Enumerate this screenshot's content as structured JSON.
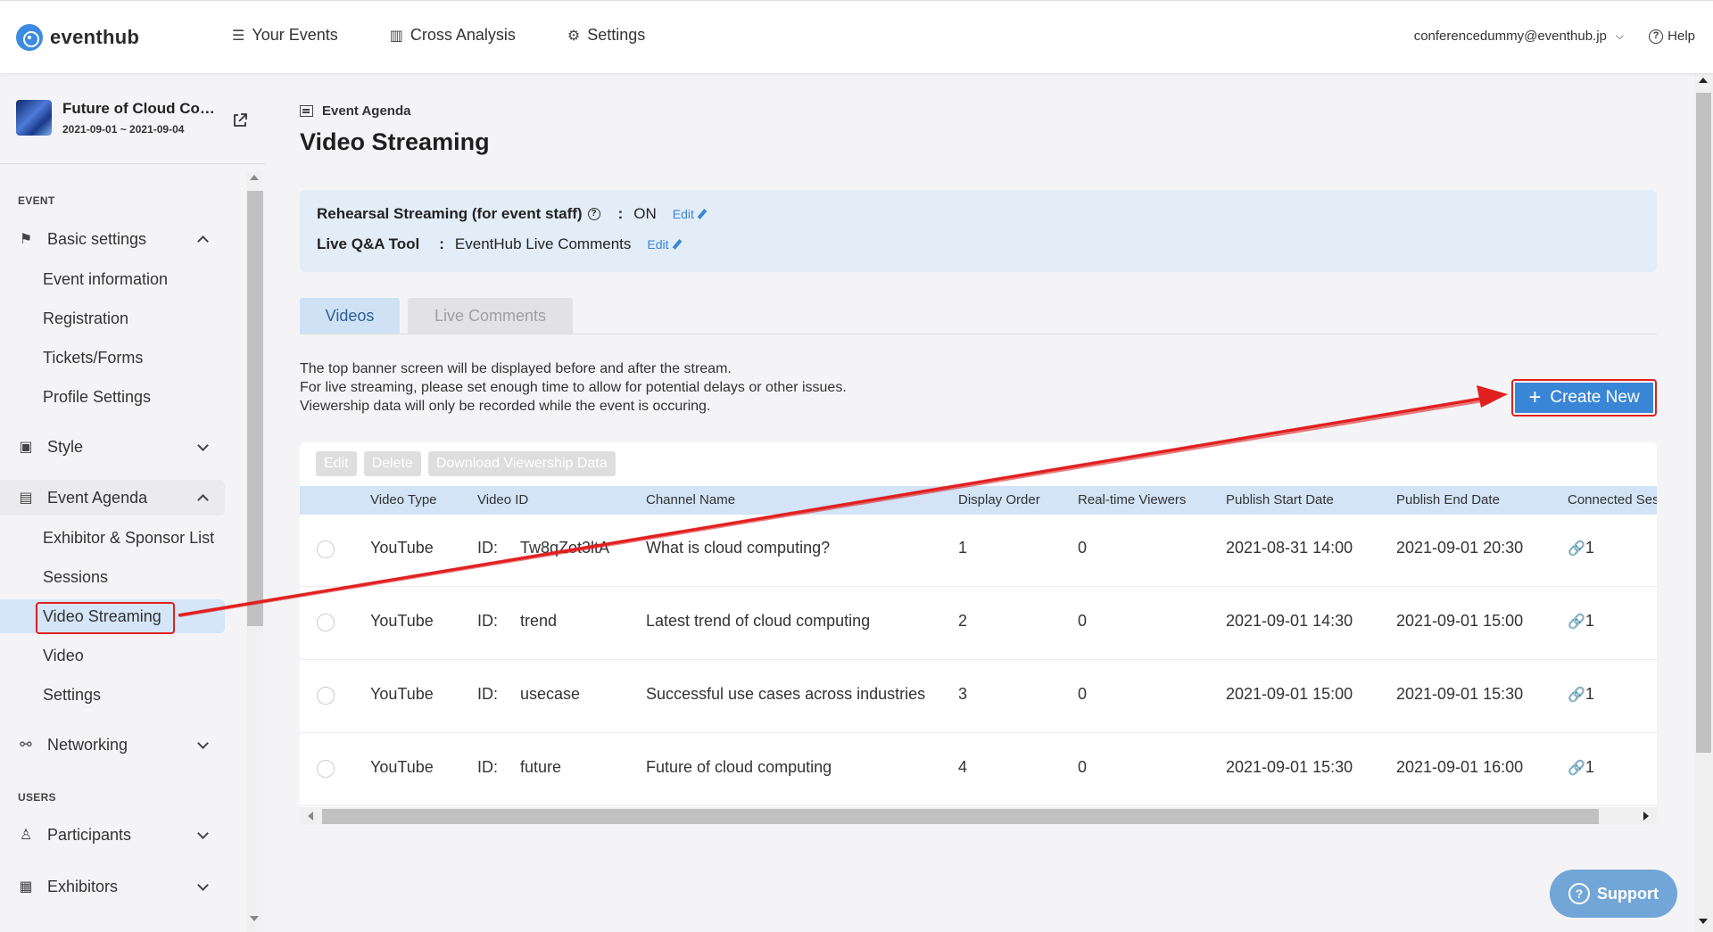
{
  "app": {
    "logo": "eventhub"
  },
  "topnav": [
    {
      "icon": "list-icon",
      "label": "Your Events"
    },
    {
      "icon": "bar-chart-icon",
      "label": "Cross Analysis"
    },
    {
      "icon": "gear-icon",
      "label": "Settings"
    }
  ],
  "user": {
    "email": "conferencedummy@eventhub.jp",
    "help": "Help"
  },
  "event": {
    "title": "Future of Cloud Computing",
    "dates": "2021-09-01 ~ 2021-09-04"
  },
  "sidebar": {
    "section_event": "EVENT",
    "section_users": "USERS",
    "groups": {
      "basic": "Basic settings",
      "style": "Style",
      "agenda": "Event Agenda",
      "networking": "Networking",
      "participants": "Participants",
      "exhibitors": "Exhibitors"
    },
    "basic_items": [
      "Event information",
      "Registration",
      "Tickets/Forms",
      "Profile Settings"
    ],
    "agenda_items": [
      "Exhibitor & Sponsor List",
      "Sessions",
      "Video Streaming",
      "Video",
      "Settings"
    ]
  },
  "page": {
    "breadcrumb": "Event Agenda",
    "title": "Video Streaming"
  },
  "info": {
    "rehearsal_label": "Rehearsal Streaming (for event staff)",
    "rehearsal_value": "ON",
    "qa_label": "Live Q&A Tool",
    "qa_value": "EventHub Live Comments",
    "edit": "Edit",
    "sep": ":"
  },
  "tabs": [
    "Videos",
    "Live Comments"
  ],
  "notes": [
    "The top banner screen will be displayed before and after the stream.",
    "For live streaming, please set enough time to allow for potential delays or other issues.",
    "Viewership data will only be recorded while the event is occuring."
  ],
  "create_button": "Create New",
  "table": {
    "actions": [
      "Edit",
      "Delete",
      "Download Viewership Data"
    ],
    "columns": [
      "Video Type",
      "Video ID",
      "Channel Name",
      "Display Order",
      "Real-time Viewers",
      "Publish Start Date",
      "Publish End Date",
      "Connected Ses"
    ],
    "id_prefix": "ID:",
    "rows": [
      {
        "type": "YouTube",
        "id": "Tw8qZot3ltA",
        "channel": "What is cloud computing?",
        "order": "1",
        "viewers": "0",
        "start": "2021-08-31 14:00",
        "end": "2021-09-01 20:30",
        "sessions": "1"
      },
      {
        "type": "YouTube",
        "id": "trend",
        "channel": "Latest trend of cloud computing",
        "order": "2",
        "viewers": "0",
        "start": "2021-09-01 14:30",
        "end": "2021-09-01 15:00",
        "sessions": "1"
      },
      {
        "type": "YouTube",
        "id": "usecase",
        "channel": "Successful use cases across industries",
        "order": "3",
        "viewers": "0",
        "start": "2021-09-01 15:00",
        "end": "2021-09-01 15:30",
        "sessions": "1"
      },
      {
        "type": "YouTube",
        "id": "future",
        "channel": "Future of cloud computing",
        "order": "4",
        "viewers": "0",
        "start": "2021-09-01 15:30",
        "end": "2021-09-01 16:00",
        "sessions": "1"
      }
    ]
  },
  "support": "Support",
  "colors": {
    "accent": "#3a86d6",
    "annotation": "#e02020",
    "active_bg": "#d4e6f8"
  }
}
